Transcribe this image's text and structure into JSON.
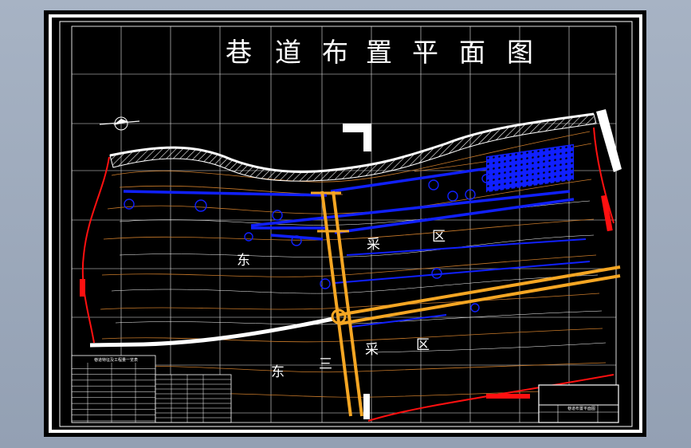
{
  "drawing": {
    "title_chars": [
      "巷",
      "道",
      "布",
      "置",
      "平",
      "面",
      "图"
    ],
    "zone_upper": [
      "东",
      "采",
      "区"
    ],
    "zone_lower": [
      "东",
      "三",
      "采",
      "区"
    ],
    "legend_table_title": "巷道特征及工程量一览表",
    "legend_table_rows": 10,
    "side_table_rows": 10,
    "title_block": "巷道布置平面图",
    "colors": {
      "background": "#000000",
      "grid": "#e8e8e8",
      "roadway_blue": "#1020ff",
      "main_roadway_orange": "#f5a623",
      "boundary_red": "#ff1010",
      "contour": "#c97a2a",
      "outcrop": "#ffffff"
    }
  }
}
